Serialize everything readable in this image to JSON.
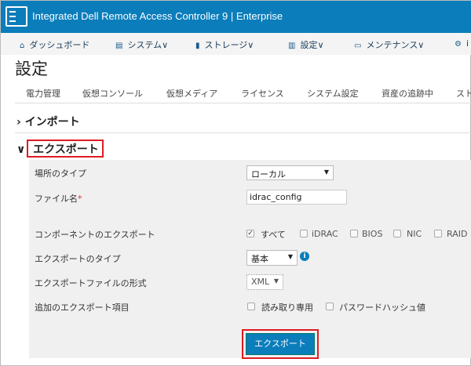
{
  "header": {
    "title": "Integrated Dell Remote Access Controller 9",
    "edition": "Enterprise"
  },
  "nav": [
    {
      "label": "ダッシュボード",
      "icon": "home-icon"
    },
    {
      "label": "システム∨",
      "icon": "server-icon"
    },
    {
      "label": "ストレージ∨",
      "icon": "database-icon"
    },
    {
      "label": "設定∨",
      "icon": "settings-grid-icon"
    },
    {
      "label": "メンテナンス∨",
      "icon": "monitor-icon"
    },
    {
      "label": "i",
      "icon": "gears-icon"
    }
  ],
  "page_title": "設定",
  "tabs": [
    "電力管理",
    "仮想コンソール",
    "仮想メディア",
    "ライセンス",
    "システム設定",
    "資産の追跡中",
    "スト"
  ],
  "sections": {
    "import": "インポート",
    "export": "エクスポート"
  },
  "form": {
    "location_label": "場所のタイプ",
    "location_value": "ローカル",
    "filename_label": "ファイル名",
    "required_mark": "*",
    "filename_value": "idrac_config",
    "components_label": "コンポーネントのエクスポート",
    "components": [
      {
        "label": "すべて",
        "checked": true
      },
      {
        "label": "iDRAC",
        "checked": false
      },
      {
        "label": "BIOS",
        "checked": false
      },
      {
        "label": "NIC",
        "checked": false
      },
      {
        "label": "RAID",
        "checked": false
      }
    ],
    "type_label": "エクスポートのタイプ",
    "type_value": "基本",
    "format_label": "エクスポートファイルの形式",
    "format_value": "XML",
    "extra_label": "追加のエクスポート項目",
    "extras": [
      {
        "label": "読み取り専用",
        "checked": false
      },
      {
        "label": "パスワードハッシュ値",
        "checked": false
      }
    ],
    "export_button": "エクスポート"
  }
}
